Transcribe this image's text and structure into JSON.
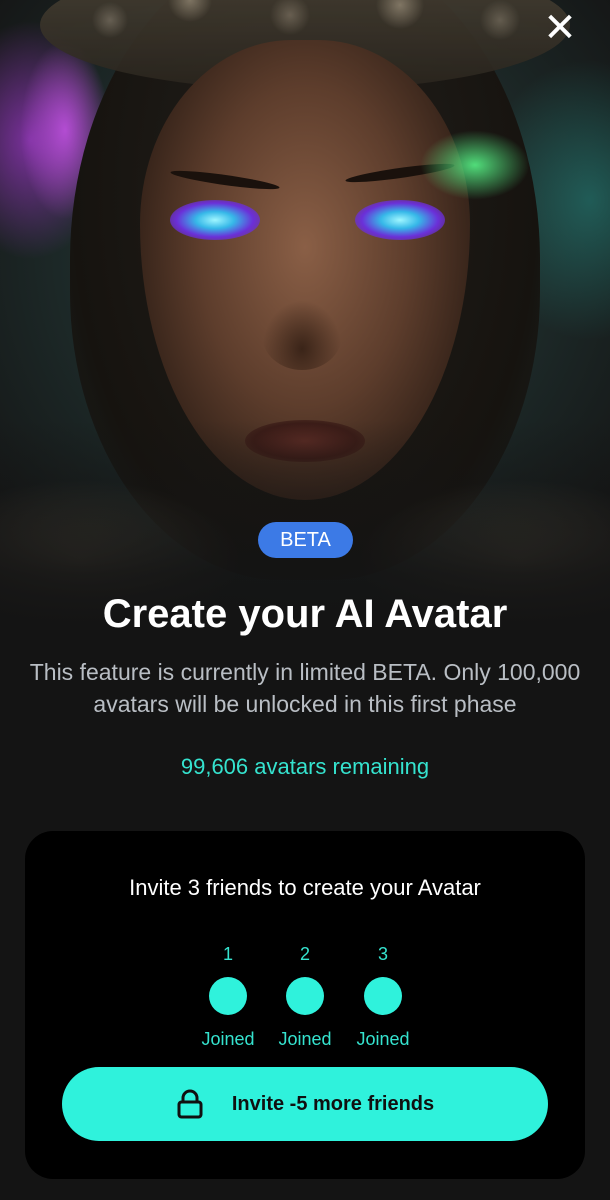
{
  "header": {
    "close_icon": "close-icon",
    "close_glyph": "✕"
  },
  "hero": {
    "image": "ai-avatar-portrait"
  },
  "badge": {
    "label": "BETA",
    "color": "#3c7ae6"
  },
  "title": "Create your AI Avatar",
  "description": "This feature is currently in limited BETA. Only 100,000 avatars will be unlocked in this first phase",
  "remaining": "99,606 avatars remaining",
  "invite_card": {
    "title": "Invite 3 friends to create your Avatar",
    "friends": [
      {
        "number": "1",
        "status": "Joined"
      },
      {
        "number": "2",
        "status": "Joined"
      },
      {
        "number": "3",
        "status": "Joined"
      }
    ],
    "button": {
      "label": "Invite -5 more friends",
      "icon": "lock-icon"
    }
  },
  "colors": {
    "accent": "#2ff2dc",
    "accent_text": "#35e3cf",
    "background": "#141414",
    "card": "#000000"
  }
}
